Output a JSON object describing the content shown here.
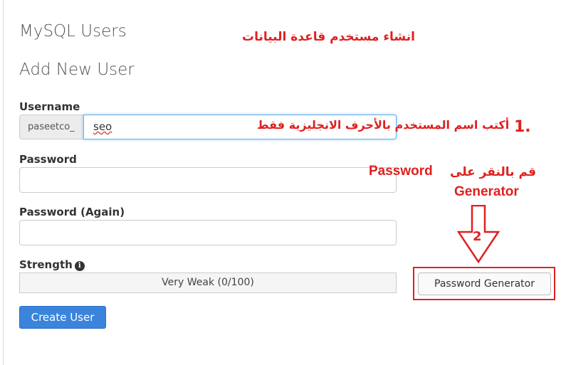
{
  "header": {
    "title": "MySQL Users",
    "subtitle": "Add New User"
  },
  "form": {
    "username_label": "Username",
    "username_prefix": "paseetco_",
    "username_value": "seo",
    "password_label": "Password",
    "password_again_label": "Password (Again)",
    "strength_label": "Strength",
    "strength_value": "Very Weak (0/100)",
    "generator_button": "Password Generator",
    "create_button": "Create User"
  },
  "annotations": {
    "title": "انشاء مستخدم قاعدة البيانات",
    "step1_number": "1.",
    "step1_text": "أكتب اسم المستخدم بالأحرف الانجليزية فقط",
    "step2_number": "2",
    "step2_text_ar": "قم بالنقر على",
    "step2_text_en1": "Password",
    "step2_text_en2": "Generator"
  },
  "colors": {
    "annotation": "#e02020",
    "primary_button": "#3a84dc",
    "focus_border": "#66afe9"
  }
}
